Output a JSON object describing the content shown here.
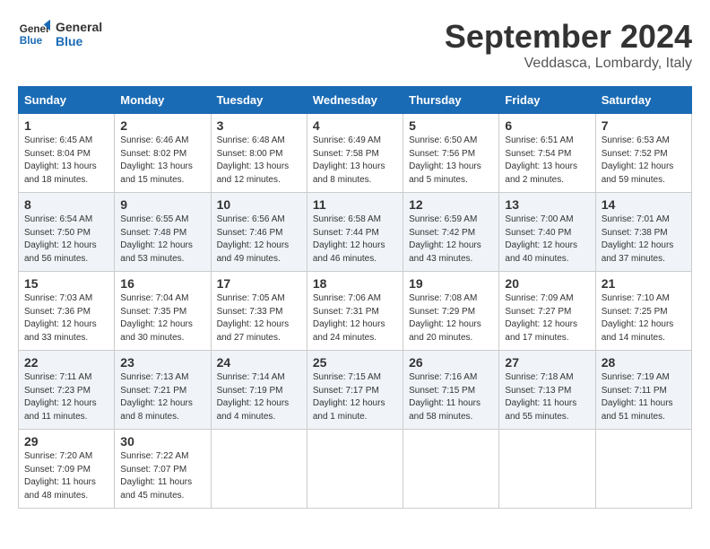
{
  "logo": {
    "line1": "General",
    "line2": "Blue"
  },
  "title": "September 2024",
  "location": "Veddasca, Lombardy, Italy",
  "days_of_week": [
    "Sunday",
    "Monday",
    "Tuesday",
    "Wednesday",
    "Thursday",
    "Friday",
    "Saturday"
  ],
  "weeks": [
    [
      {
        "day": "1",
        "sunrise": "6:45 AM",
        "sunset": "8:04 PM",
        "daylight": "13 hours and 18 minutes."
      },
      {
        "day": "2",
        "sunrise": "6:46 AM",
        "sunset": "8:02 PM",
        "daylight": "13 hours and 15 minutes."
      },
      {
        "day": "3",
        "sunrise": "6:48 AM",
        "sunset": "8:00 PM",
        "daylight": "13 hours and 12 minutes."
      },
      {
        "day": "4",
        "sunrise": "6:49 AM",
        "sunset": "7:58 PM",
        "daylight": "13 hours and 8 minutes."
      },
      {
        "day": "5",
        "sunrise": "6:50 AM",
        "sunset": "7:56 PM",
        "daylight": "13 hours and 5 minutes."
      },
      {
        "day": "6",
        "sunrise": "6:51 AM",
        "sunset": "7:54 PM",
        "daylight": "13 hours and 2 minutes."
      },
      {
        "day": "7",
        "sunrise": "6:53 AM",
        "sunset": "7:52 PM",
        "daylight": "12 hours and 59 minutes."
      }
    ],
    [
      {
        "day": "8",
        "sunrise": "6:54 AM",
        "sunset": "7:50 PM",
        "daylight": "12 hours and 56 minutes."
      },
      {
        "day": "9",
        "sunrise": "6:55 AM",
        "sunset": "7:48 PM",
        "daylight": "12 hours and 53 minutes."
      },
      {
        "day": "10",
        "sunrise": "6:56 AM",
        "sunset": "7:46 PM",
        "daylight": "12 hours and 49 minutes."
      },
      {
        "day": "11",
        "sunrise": "6:58 AM",
        "sunset": "7:44 PM",
        "daylight": "12 hours and 46 minutes."
      },
      {
        "day": "12",
        "sunrise": "6:59 AM",
        "sunset": "7:42 PM",
        "daylight": "12 hours and 43 minutes."
      },
      {
        "day": "13",
        "sunrise": "7:00 AM",
        "sunset": "7:40 PM",
        "daylight": "12 hours and 40 minutes."
      },
      {
        "day": "14",
        "sunrise": "7:01 AM",
        "sunset": "7:38 PM",
        "daylight": "12 hours and 37 minutes."
      }
    ],
    [
      {
        "day": "15",
        "sunrise": "7:03 AM",
        "sunset": "7:36 PM",
        "daylight": "12 hours and 33 minutes."
      },
      {
        "day": "16",
        "sunrise": "7:04 AM",
        "sunset": "7:35 PM",
        "daylight": "12 hours and 30 minutes."
      },
      {
        "day": "17",
        "sunrise": "7:05 AM",
        "sunset": "7:33 PM",
        "daylight": "12 hours and 27 minutes."
      },
      {
        "day": "18",
        "sunrise": "7:06 AM",
        "sunset": "7:31 PM",
        "daylight": "12 hours and 24 minutes."
      },
      {
        "day": "19",
        "sunrise": "7:08 AM",
        "sunset": "7:29 PM",
        "daylight": "12 hours and 20 minutes."
      },
      {
        "day": "20",
        "sunrise": "7:09 AM",
        "sunset": "7:27 PM",
        "daylight": "12 hours and 17 minutes."
      },
      {
        "day": "21",
        "sunrise": "7:10 AM",
        "sunset": "7:25 PM",
        "daylight": "12 hours and 14 minutes."
      }
    ],
    [
      {
        "day": "22",
        "sunrise": "7:11 AM",
        "sunset": "7:23 PM",
        "daylight": "12 hours and 11 minutes."
      },
      {
        "day": "23",
        "sunrise": "7:13 AM",
        "sunset": "7:21 PM",
        "daylight": "12 hours and 8 minutes."
      },
      {
        "day": "24",
        "sunrise": "7:14 AM",
        "sunset": "7:19 PM",
        "daylight": "12 hours and 4 minutes."
      },
      {
        "day": "25",
        "sunrise": "7:15 AM",
        "sunset": "7:17 PM",
        "daylight": "12 hours and 1 minute."
      },
      {
        "day": "26",
        "sunrise": "7:16 AM",
        "sunset": "7:15 PM",
        "daylight": "11 hours and 58 minutes."
      },
      {
        "day": "27",
        "sunrise": "7:18 AM",
        "sunset": "7:13 PM",
        "daylight": "11 hours and 55 minutes."
      },
      {
        "day": "28",
        "sunrise": "7:19 AM",
        "sunset": "7:11 PM",
        "daylight": "11 hours and 51 minutes."
      }
    ],
    [
      {
        "day": "29",
        "sunrise": "7:20 AM",
        "sunset": "7:09 PM",
        "daylight": "11 hours and 48 minutes."
      },
      {
        "day": "30",
        "sunrise": "7:22 AM",
        "sunset": "7:07 PM",
        "daylight": "11 hours and 45 minutes."
      },
      null,
      null,
      null,
      null,
      null
    ]
  ]
}
